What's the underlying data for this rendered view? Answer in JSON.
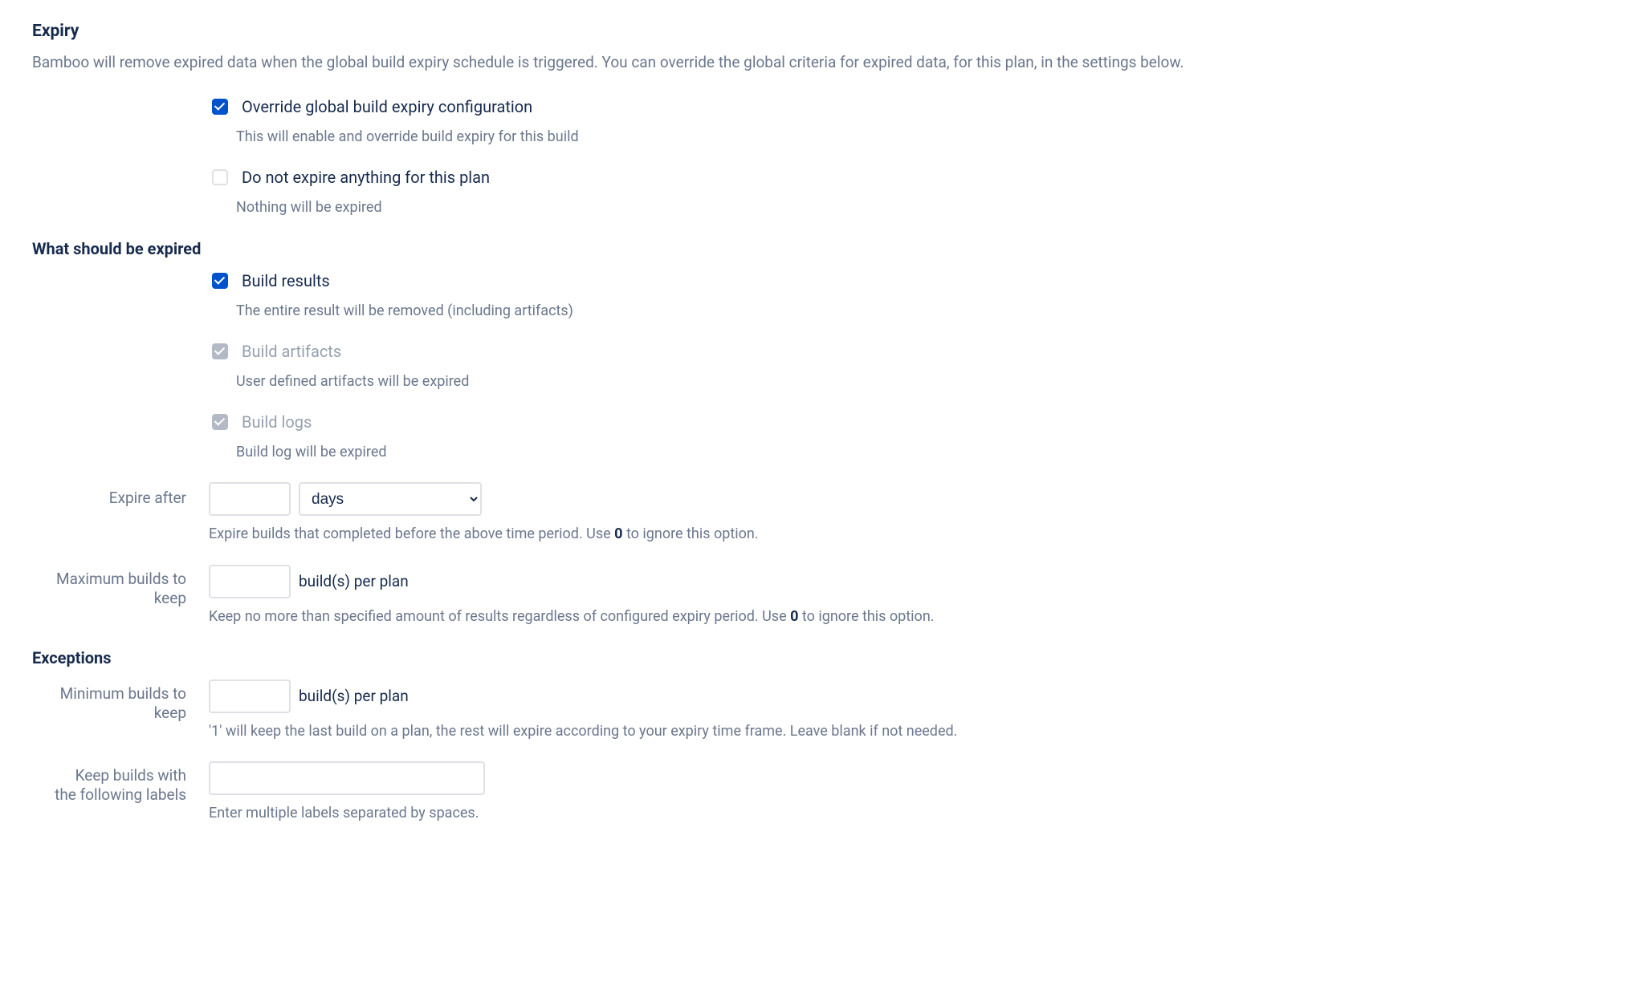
{
  "expiry": {
    "heading": "Expiry",
    "description": "Bamboo will remove expired data when the global build expiry schedule is triggered. You can override the global criteria for expired data, for this plan, in the settings below.",
    "override": {
      "label": "Override global build expiry configuration",
      "helper": "This will enable and override build expiry for this build",
      "checked": true
    },
    "doNotExpire": {
      "label": "Do not expire anything for this plan",
      "helper": "Nothing will be expired",
      "checked": false
    }
  },
  "whatExpired": {
    "heading": "What should be expired",
    "buildResults": {
      "label": "Build results",
      "helper": "The entire result will be removed (including artifacts)",
      "checked": true,
      "disabled": false
    },
    "buildArtifacts": {
      "label": "Build artifacts",
      "helper": "User defined artifacts will be expired",
      "checked": true,
      "disabled": true
    },
    "buildLogs": {
      "label": "Build logs",
      "helper": "Build log will be expired",
      "checked": true,
      "disabled": true
    },
    "expireAfter": {
      "label": "Expire after",
      "value": "",
      "unitSelected": "days",
      "helperPrefix": "Expire builds that completed before the above time period. Use ",
      "helperBold": "0",
      "helperSuffix": " to ignore this option."
    },
    "maxBuilds": {
      "labelLine1": "Maximum builds to",
      "labelLine2": "keep",
      "value": "",
      "suffix": "build(s) per plan",
      "helperPrefix": "Keep no more than specified amount of results regardless of configured expiry period. Use ",
      "helperBold": "0",
      "helperSuffix": " to ignore this option."
    }
  },
  "exceptions": {
    "heading": "Exceptions",
    "minBuilds": {
      "labelLine1": "Minimum builds to",
      "labelLine2": "keep",
      "value": "",
      "suffix": "build(s) per plan",
      "helper": "'1' will keep the last build on a plan, the rest will expire according to your expiry time frame. Leave blank if not needed."
    },
    "keepLabels": {
      "labelLine1": "Keep builds with",
      "labelLine2": "the following labels",
      "value": "",
      "helper": "Enter multiple labels separated by spaces."
    }
  }
}
